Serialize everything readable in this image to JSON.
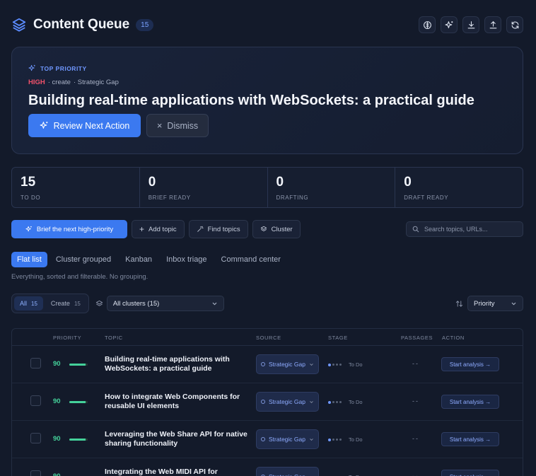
{
  "header": {
    "title": "Content Queue",
    "count": "15",
    "toolbar_icons": [
      "brain-icon",
      "sparkles-icon",
      "download-icon",
      "upload-icon",
      "refresh-icon"
    ]
  },
  "top_priority": {
    "label": "TOP PRIORITY",
    "level": "HIGH",
    "action": "· create",
    "source": "· Strategic Gap",
    "title": "Building real-time applications with WebSockets: a practical guide",
    "primary_label": "Review Next Action",
    "dismiss_label": "Dismiss"
  },
  "stats": [
    {
      "value": "15",
      "label": "TO DO"
    },
    {
      "value": "0",
      "label": "BRIEF READY"
    },
    {
      "value": "0",
      "label": "DRAFTING"
    },
    {
      "value": "0",
      "label": "DRAFT READY"
    }
  ],
  "actions": {
    "brief_label": "Brief the next high-priority",
    "add_label": "Add topic",
    "find_label": "Find topics",
    "cluster_label": "Cluster",
    "search_placeholder": "Search topics, URLs..."
  },
  "tabs": {
    "items": [
      "Flat list",
      "Cluster grouped",
      "Kanban",
      "Inbox triage",
      "Command center"
    ],
    "active": "Flat list",
    "description": "Everything, sorted and filterable. No grouping."
  },
  "filters": {
    "all_label": "All",
    "all_count": "15",
    "create_label": "Create",
    "create_count": "15",
    "cluster_value": "All clusters (15)",
    "sort_value": "Priority"
  },
  "table": {
    "headers": {
      "priority": "PRIORITY",
      "topic": "TOPIC",
      "source": "SOURCE",
      "stage": "STAGE",
      "passages": "PASSAGES",
      "action": "ACTION"
    },
    "rows": [
      {
        "score": "90",
        "score_fraction": 0.9,
        "topic": "Building real-time applications with WebSockets: a practical guide",
        "source": "Strategic Gap",
        "stage": "To Do",
        "passages": "--",
        "action": "Start analysis →"
      },
      {
        "score": "90",
        "score_fraction": 0.9,
        "topic": "How to integrate Web Components for reusable UI elements",
        "source": "Strategic Gap",
        "stage": "To Do",
        "passages": "--",
        "action": "Start analysis →"
      },
      {
        "score": "90",
        "score_fraction": 0.9,
        "topic": "Leveraging the Web Share API for native sharing functionality",
        "source": "Strategic Gap",
        "stage": "To Do",
        "passages": "--",
        "action": "Start analysis →"
      },
      {
        "score": "90",
        "score_fraction": 0.9,
        "topic": "Integrating the Web MIDI API for",
        "source": "Strategic Gap",
        "stage": "To Do",
        "passages": "--",
        "action": "Start analysis →"
      }
    ]
  }
}
